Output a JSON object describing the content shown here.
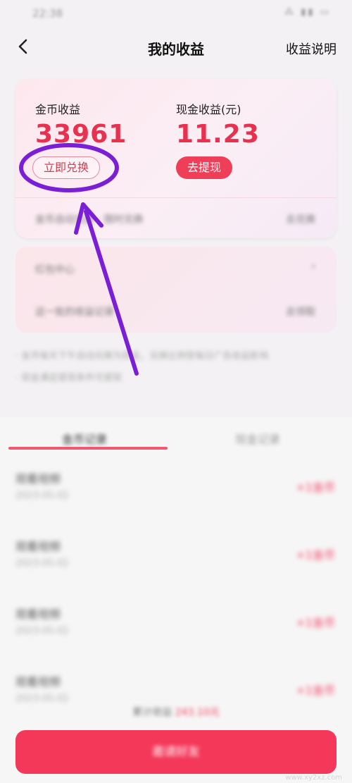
{
  "status": {
    "time": "22:38",
    "icons": "⁂ ▮▮ ▭"
  },
  "nav": {
    "title": "我的收益",
    "explain": "收益说明"
  },
  "coins": {
    "label": "金币收益",
    "value": "33961",
    "button": "立即兑换"
  },
  "cash": {
    "label": "现金收益(元)",
    "value": "11.23",
    "button": "去提现"
  },
  "card_row": {
    "left": "金币自动兑换 · 限时兑换",
    "right": "去兑换"
  },
  "second_card": {
    "row1_left": "红包中心",
    "row1_right": "›",
    "row2_left": "这一批的收益记录",
    "row2_right": "去领取"
  },
  "notes": [
    "· 金币每天下午自动兑换为现金，兑换比例受每日广告收益影响",
    "· 现金满足提现条件可提现"
  ],
  "tabs": {
    "left": "金币记录",
    "right": "现金记录"
  },
  "records": [
    {
      "title": "观看视频",
      "date": "2023-05-02",
      "amount": "+1金币"
    },
    {
      "title": "观看视频",
      "date": "2023-05-02",
      "amount": "+1金币"
    },
    {
      "title": "观看视频",
      "date": "2023-05-02",
      "amount": "+1金币"
    },
    {
      "title": "观看视频",
      "date": "2023-05-02",
      "amount": "+1金币"
    }
  ],
  "footer": {
    "label": "累计收益",
    "amount": "243.10元"
  },
  "bottom_button": "邀请好友",
  "watermark": "www.xy2xz.com",
  "colors": {
    "accent": "#ee3e58",
    "annotation": "#7a1fd6"
  }
}
